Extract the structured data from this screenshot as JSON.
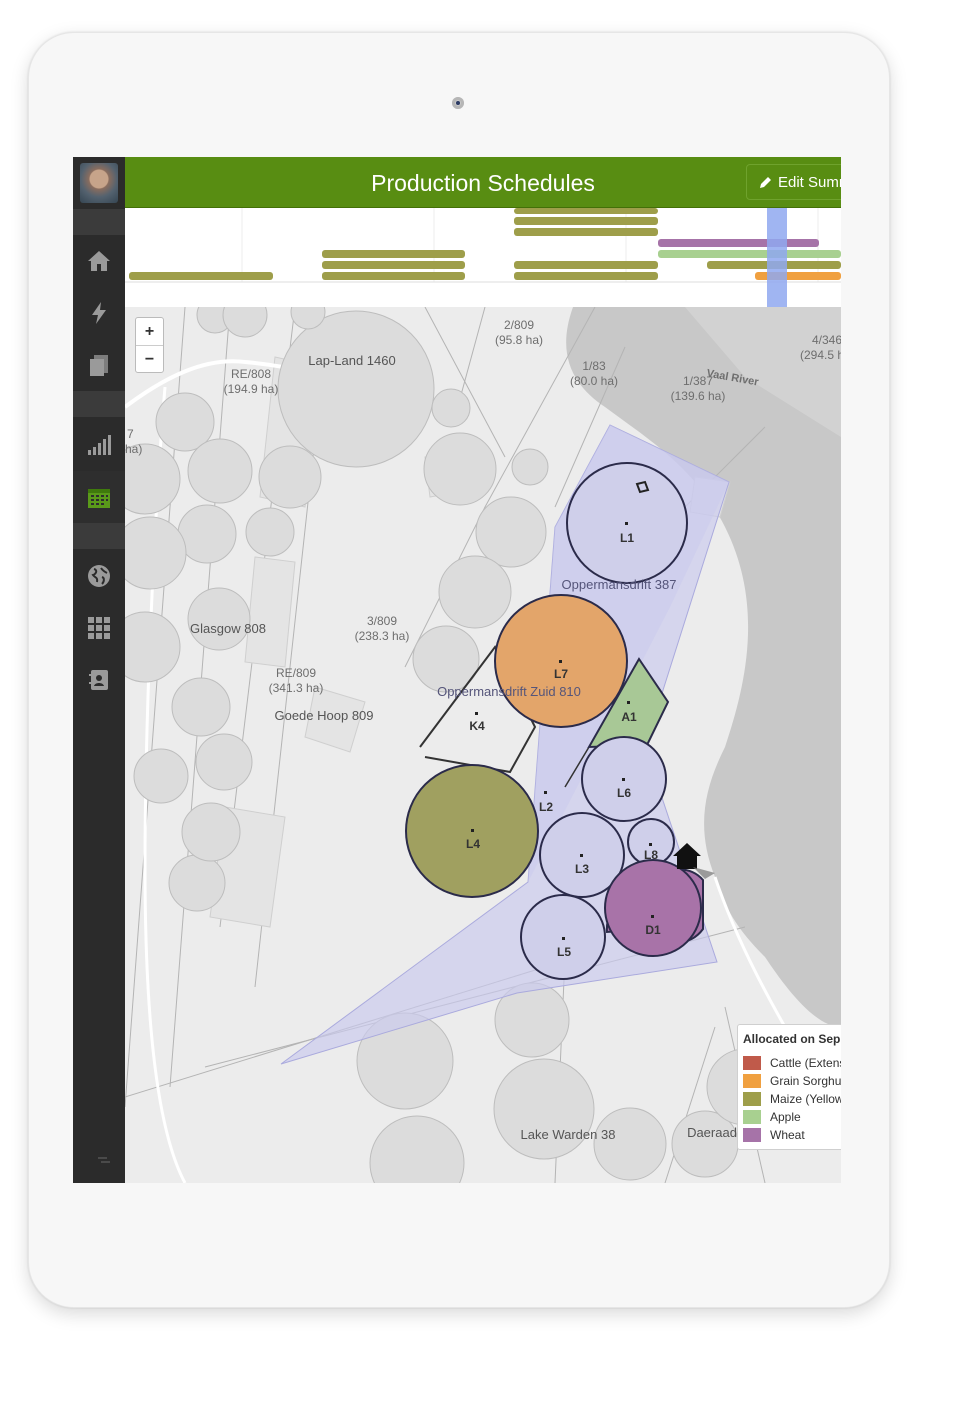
{
  "app": {
    "title": "Production Schedules",
    "edit_button_label": "Edit Summ"
  },
  "sidebar": {
    "items": [
      {
        "name": "home",
        "icon": "home-icon"
      },
      {
        "name": "activity",
        "icon": "lightning-icon"
      },
      {
        "name": "documents",
        "icon": "documents-icon"
      },
      {
        "name": "reports",
        "icon": "bar-chart-icon"
      },
      {
        "name": "schedules",
        "icon": "calendar-icon",
        "active": true
      },
      {
        "name": "map",
        "icon": "globe-icon"
      },
      {
        "name": "apps",
        "icon": "grid-icon"
      },
      {
        "name": "contacts",
        "icon": "contacts-icon"
      }
    ]
  },
  "colors": {
    "header_green": "#588d12",
    "maize": "#9e9e4a",
    "cattle": "#c05a4a",
    "grain_sorghum": "#f0a040",
    "apple": "#a8d090",
    "wheat": "#a673a8",
    "current_marker": "#8fa8f0",
    "farm_area": "#c9c9ee"
  },
  "map": {
    "zoom_in": "+",
    "zoom_out": "−",
    "parcels": [
      {
        "name": "Lap-Land 1460"
      },
      {
        "name": "RE/808",
        "area": "(194.9 ha)"
      },
      {
        "name": "2/809",
        "area": "(95.8 ha)"
      },
      {
        "name": "1/83",
        "area": "(80.0 ha)"
      },
      {
        "name": "1/387",
        "area": "(139.6 ha)"
      },
      {
        "name": "4/346",
        "area": "(294.5 h"
      },
      {
        "name": "Vaal River"
      },
      {
        "name": "Glasgow 808"
      },
      {
        "name": "3/809",
        "area": "(238.3 ha)"
      },
      {
        "name": "RE/809",
        "area": "(341.3 ha)"
      },
      {
        "name": "Goede Hoop 809"
      },
      {
        "name": "Oppermansdrift 387"
      },
      {
        "name": "Oppermansdrift Zuid 810"
      },
      {
        "name": "Lake Warden 38"
      },
      {
        "name": "Daeraad"
      },
      {
        "name": "7",
        "area": "ha)"
      }
    ],
    "fields": [
      "L1",
      "L7",
      "A1",
      "K4",
      "L6",
      "L2",
      "L4",
      "L3",
      "L8",
      "D1",
      "L5"
    ]
  },
  "legend": {
    "title": "Allocated on Sep",
    "items": [
      {
        "label": "Cattle (Extens",
        "color": "#c05a4a"
      },
      {
        "label": "Grain Sorghur",
        "color": "#f0a040"
      },
      {
        "label": "Maize (Yellow)",
        "color": "#9e9e4a"
      },
      {
        "label": "Apple",
        "color": "#a8d090"
      },
      {
        "label": "Wheat",
        "color": "#a673a8"
      }
    ]
  }
}
